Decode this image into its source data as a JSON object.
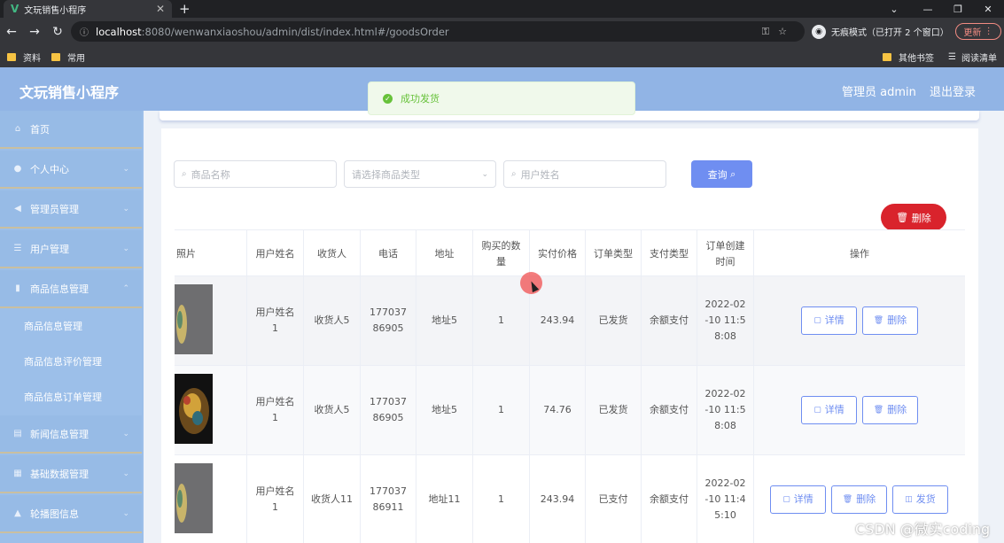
{
  "browser": {
    "tab_title": "文玩销售小程序",
    "url_host": "localhost",
    "url_rest": ":8080/wenwanxiaoshou/admin/dist/index.html#/goodsOrder",
    "incognito_label": "无痕模式（已打开 2 个窗口）",
    "update_label": "更新",
    "bookmarks": [
      "资料",
      "常用",
      "其他书签",
      "阅读清单"
    ]
  },
  "header": {
    "app_title": "文玩销售小程序",
    "user_label": "管理员 admin",
    "logout_label": "退出登录"
  },
  "toast": {
    "message": "成功发货",
    "color": "#67c23a"
  },
  "sidebar": {
    "items": [
      {
        "label": "首页",
        "icon": "home-icon"
      },
      {
        "label": "个人中心",
        "icon": "user-icon"
      },
      {
        "label": "管理员管理",
        "icon": "megaphone-icon"
      },
      {
        "label": "用户管理",
        "icon": "list-icon"
      },
      {
        "label": "商品信息管理",
        "icon": "chart-icon"
      },
      {
        "label": "新闻信息管理",
        "icon": "news-icon"
      },
      {
        "label": "基础数据管理",
        "icon": "grid-icon"
      },
      {
        "label": "轮播图信息",
        "icon": "person-icon"
      }
    ],
    "subitems": [
      "商品信息管理",
      "商品信息评价管理",
      "商品信息订单管理"
    ]
  },
  "search": {
    "name_placeholder": "商品名称",
    "type_placeholder": "请选择商品类型",
    "user_placeholder": "用户姓名",
    "query_label": "查询",
    "delete_label": "删除"
  },
  "table": {
    "headers": [
      "照片",
      "用户姓名",
      "收货人",
      "电话",
      "地址",
      "购买的数量",
      "实付价格",
      "订单类型",
      "支付类型",
      "订单创建时间",
      "操作"
    ],
    "rows": [
      {
        "user": "用户姓名1",
        "receiver": "收货人5",
        "phone": "17703786905",
        "address": "地址5",
        "qty": "1",
        "price": "243.94",
        "order_type": "已发货",
        "pay_type": "余额支付",
        "created": "2022-02-10 11:58:08",
        "actions": [
          "详情",
          "删除"
        ]
      },
      {
        "user": "用户姓名1",
        "receiver": "收货人5",
        "phone": "17703786905",
        "address": "地址5",
        "qty": "1",
        "price": "74.76",
        "order_type": "已发货",
        "pay_type": "余额支付",
        "created": "2022-02-10 11:58:08",
        "actions": [
          "详情",
          "删除"
        ]
      },
      {
        "user": "用户姓名1",
        "receiver": "收货人11",
        "phone": "17703786911",
        "address": "地址11",
        "qty": "1",
        "price": "243.94",
        "order_type": "已支付",
        "pay_type": "余额支付",
        "created": "2022-02-10 11:45:10",
        "actions": [
          "详情",
          "删除",
          "发货"
        ]
      }
    ]
  },
  "watermark": "CSDN @微实coding",
  "colors": {
    "header": "#91b4e5",
    "sidebar": "#9cbfe9",
    "primary": "#6f8ef1",
    "danger": "#d9232c"
  }
}
